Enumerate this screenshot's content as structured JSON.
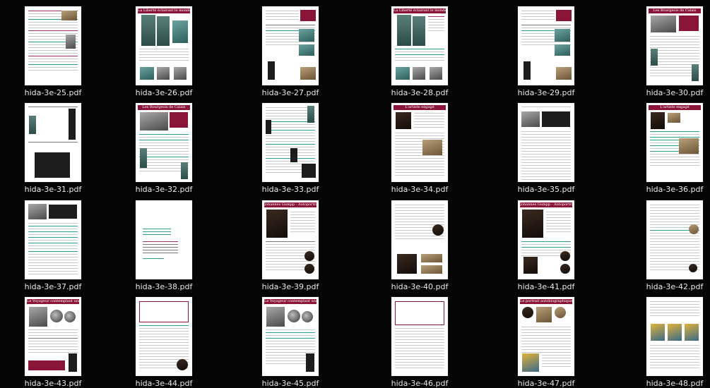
{
  "files": [
    {
      "name": "hida-3e-25.pdf"
    },
    {
      "name": "hida-3e-26.pdf",
      "banner": "La Liberté éclairant le monde"
    },
    {
      "name": "hida-3e-27.pdf"
    },
    {
      "name": "hida-3e-28.pdf",
      "banner": "La Liberté éclairant le monde"
    },
    {
      "name": "hida-3e-29.pdf"
    },
    {
      "name": "hida-3e-30.pdf",
      "banner": "Les Bourgeois de Calais"
    },
    {
      "name": "hida-3e-31.pdf"
    },
    {
      "name": "hida-3e-32.pdf",
      "banner": "Les Bourgeois de Calais"
    },
    {
      "name": "hida-3e-33.pdf"
    },
    {
      "name": "hida-3e-34.pdf",
      "banner": "L'artiste engagé"
    },
    {
      "name": "hida-3e-35.pdf"
    },
    {
      "name": "hida-3e-36.pdf",
      "banner": "L'artiste engagé"
    },
    {
      "name": "hida-3e-37.pdf"
    },
    {
      "name": "hida-3e-38.pdf"
    },
    {
      "name": "hida-3e-39.pdf",
      "banner": "Johannes Gumpp - Autoportrait"
    },
    {
      "name": "hida-3e-40.pdf"
    },
    {
      "name": "hida-3e-41.pdf",
      "banner": "Johannes Gumpp - Autoportrait"
    },
    {
      "name": "hida-3e-42.pdf"
    },
    {
      "name": "hida-3e-43.pdf",
      "banner": "Le Voyageur contemplant une mer de nuages"
    },
    {
      "name": "hida-3e-44.pdf"
    },
    {
      "name": "hida-3e-45.pdf",
      "banner": "Le Voyageur contemplant une mer de nuages"
    },
    {
      "name": "hida-3e-46.pdf"
    },
    {
      "name": "hida-3e-47.pdf",
      "banner": "Le portrait autobiographique"
    },
    {
      "name": "hida-3e-48.pdf"
    }
  ],
  "colors": {
    "background": "#050505",
    "label": "#e8e8e8",
    "banner": "#8b1538",
    "accent_teal": "#2f9e8f"
  },
  "icon": "pdf-document-thumbnail"
}
